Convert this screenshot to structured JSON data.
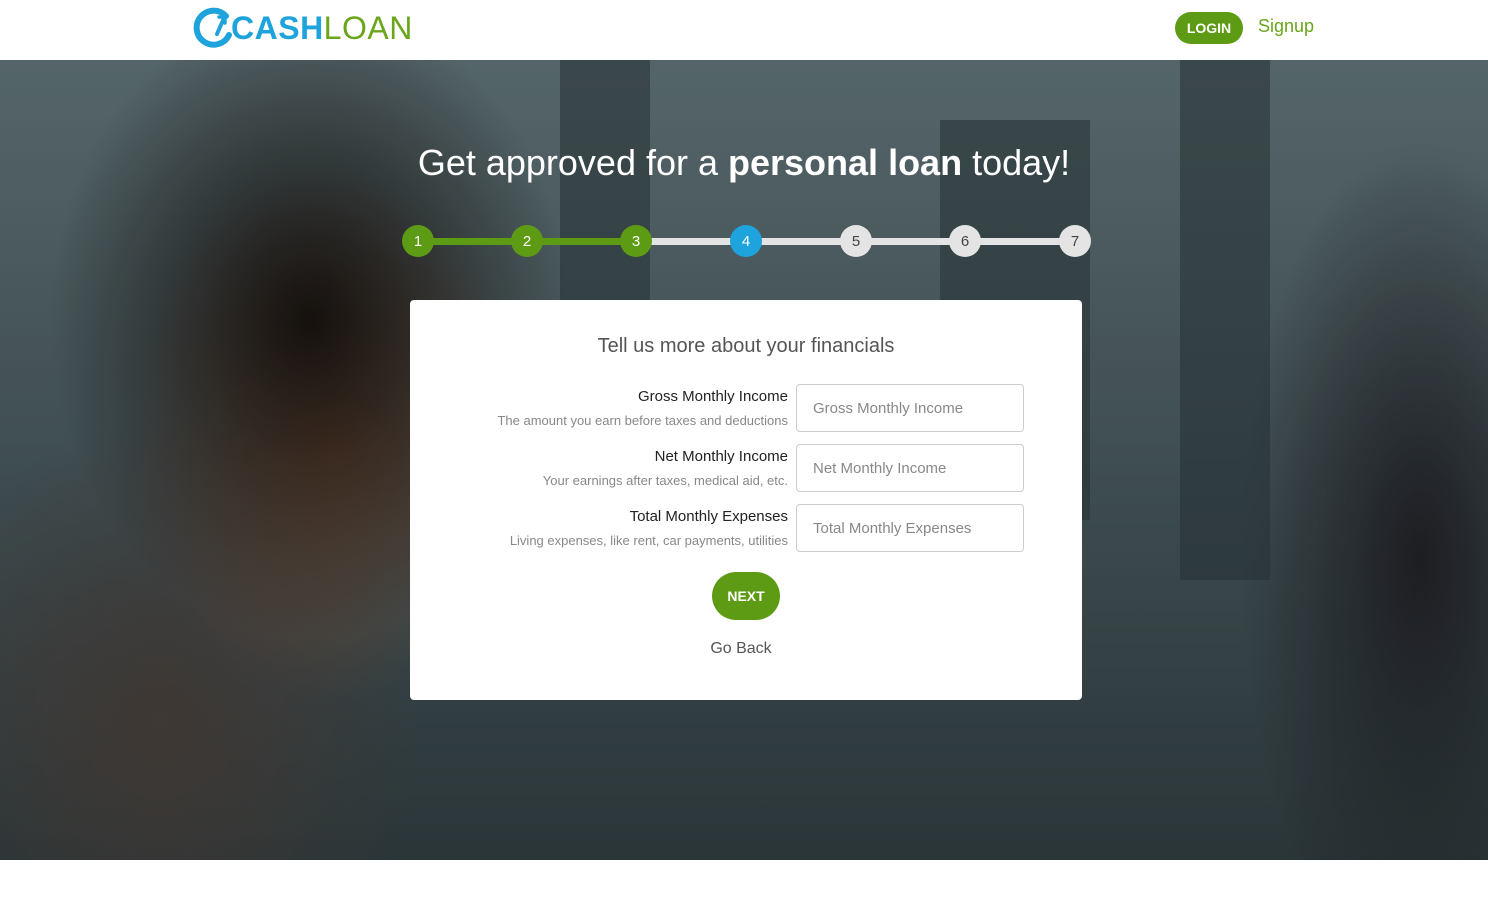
{
  "brand": {
    "logo_cash": "CASH",
    "logo_loan": "LOAN",
    "primary_color": "#5e9b14",
    "accent_color": "#1fa3dc"
  },
  "header": {
    "login_label": "LOGIN",
    "signup_label": "Signup"
  },
  "hero": {
    "title_start": "Get approved for a ",
    "title_bold": "personal loan",
    "title_end": " today!"
  },
  "stepper": {
    "current_step": 4,
    "steps": [
      "1",
      "2",
      "3",
      "4",
      "5",
      "6",
      "7"
    ]
  },
  "form": {
    "title": "Tell us more about your financials",
    "fields": [
      {
        "label": "Gross Monthly Income",
        "help": "The amount you earn before taxes and deductions",
        "placeholder": "Gross Monthly Income",
        "value": ""
      },
      {
        "label": "Net Monthly Income",
        "help": "Your earnings after taxes, medical aid, etc.",
        "placeholder": "Net Monthly Income",
        "value": ""
      },
      {
        "label": "Total Monthly Expenses",
        "help": "Living expenses, like rent, car payments, utilities",
        "placeholder": "Total Monthly Expenses",
        "value": ""
      }
    ],
    "next_label": "NEXT",
    "back_label": "Go Back"
  }
}
